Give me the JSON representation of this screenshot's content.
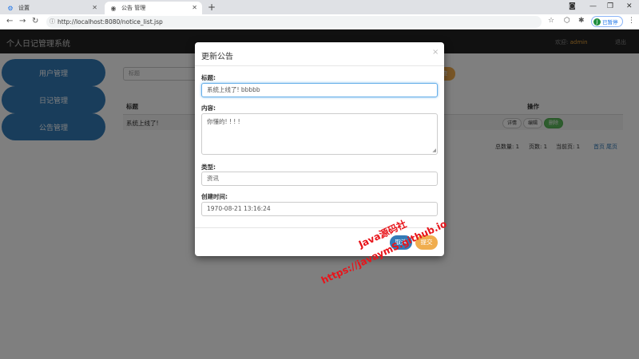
{
  "browser": {
    "tabs": [
      {
        "label": "设置",
        "icon": "gear-icon",
        "active": false
      },
      {
        "label": "公告 管理",
        "icon": "globe-icon",
        "active": true
      }
    ],
    "url": "http://localhost:8080/notice_list.jsp",
    "profile_label": "已暂停",
    "profile_initial": "J"
  },
  "app": {
    "title": "个人日记管理系统",
    "welcome_label": "欢迎:",
    "username": "admin",
    "logout_label": "退出"
  },
  "sidebar": {
    "items": [
      {
        "label": "用户管理"
      },
      {
        "label": "日记管理"
      },
      {
        "label": "公告管理"
      }
    ]
  },
  "main": {
    "search_placeholder": "标题",
    "search_button_label": "查",
    "table": {
      "headers": {
        "title": "标题",
        "actions": "操作"
      },
      "rows": [
        {
          "title": "系统上线了!",
          "detail_label": "详情",
          "edit_label": "编辑",
          "delete_label": "删除"
        }
      ]
    },
    "pager": {
      "total_label": "总数量:",
      "total_value": "1",
      "pages_label": "页数:",
      "pages_value": "1",
      "current_label": "当前页:",
      "current_value": "1",
      "first_label": "首页",
      "last_label": "尾页"
    }
  },
  "modal": {
    "title": "更新公告",
    "close_label": "×",
    "fields": {
      "title_label": "标题:",
      "title_value": "系统上线了! bbbbb",
      "content_label": "内容:",
      "content_value": "你懂的! ! ! !",
      "type_label": "类型:",
      "type_value": "资讯",
      "created_label": "创建时间:",
      "created_value": "1970-08-21 13:16:24"
    },
    "cancel_label": "取消",
    "submit_label": "提交"
  },
  "watermark": {
    "line1": "Java源码社",
    "line2": "https://javaymS.github.io"
  },
  "colors": {
    "primary": "#337ab7",
    "warning": "#f0ad4e",
    "success": "#5cb85c",
    "header_bg": "#222222",
    "watermark": "#e8141a"
  }
}
